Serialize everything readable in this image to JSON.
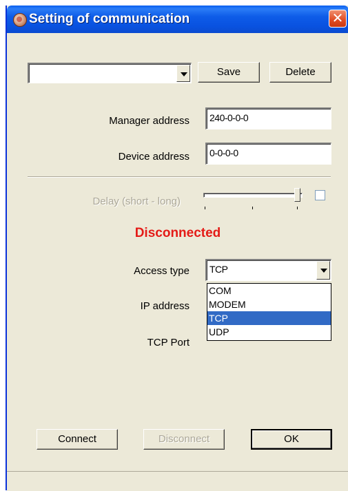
{
  "window": {
    "title": "Setting of communication",
    "close_glyph": "✕"
  },
  "profile": {
    "value": "",
    "save_label": "Save",
    "delete_label": "Delete"
  },
  "manager_address": {
    "label": "Manager address",
    "value": "240-0-0-0"
  },
  "device_address": {
    "label": "Device address",
    "value": "0-0-0-0"
  },
  "delay": {
    "label": "Delay (short - long)",
    "level": 1.0,
    "enabled": false,
    "checked": false
  },
  "status": {
    "text": "Disconnected",
    "color": "#e41b17"
  },
  "access_type": {
    "label": "Access type",
    "value": "TCP",
    "options": [
      "COM",
      "MODEM",
      "TCP",
      "UDP"
    ],
    "selected_index": 2
  },
  "ip_address": {
    "label": "IP address"
  },
  "tcp_port": {
    "label": "TCP Port"
  },
  "buttons": {
    "connect": "Connect",
    "disconnect": "Disconnect",
    "ok": "OK"
  },
  "colors": {
    "titlebar": "#0A5FEF",
    "dialog_bg": "#ECE9D8",
    "selection": "#316AC5"
  }
}
